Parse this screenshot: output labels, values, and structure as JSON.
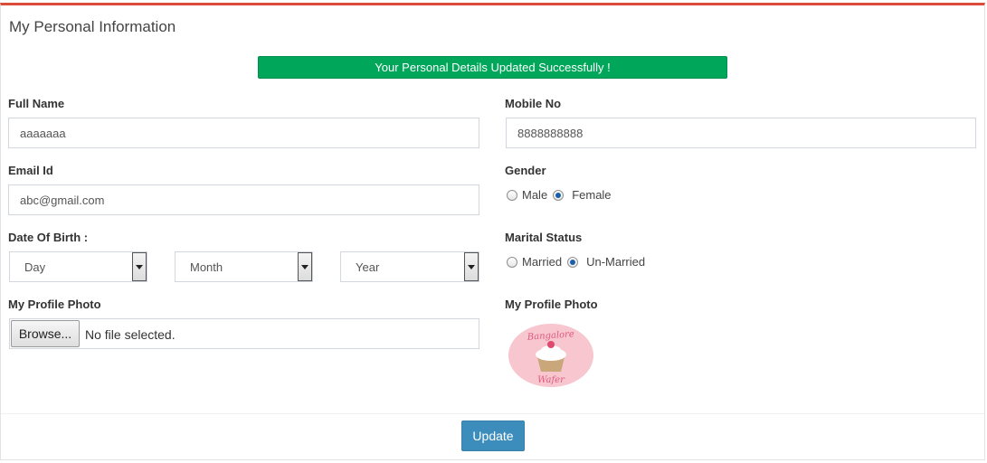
{
  "panel": {
    "title": "My Personal Information"
  },
  "alert": {
    "message": "Your Personal Details Updated Successfully !"
  },
  "fields": {
    "full_name": {
      "label": "Full Name",
      "value": "aaaaaaa"
    },
    "mobile": {
      "label": "Mobile No",
      "value": "8888888888"
    },
    "email": {
      "label": "Email Id",
      "value": "abc@gmail.com"
    },
    "gender": {
      "label": "Gender",
      "options": [
        "Male",
        "Female"
      ],
      "selected": "Female"
    },
    "dob": {
      "label": "Date Of Birth :",
      "day": "Day",
      "month": "Month",
      "year": "Year"
    },
    "marital_status": {
      "label": "Marital Status",
      "options": [
        "Married",
        "Un-Married"
      ],
      "selected": "Un-Married"
    },
    "photo_upload": {
      "label": "My Profile Photo",
      "browse_label": "Browse...",
      "status": "No file selected."
    },
    "photo_preview": {
      "label": "My Profile Photo",
      "logo_top": "Bangalore",
      "logo_bottom": "Wafer"
    }
  },
  "actions": {
    "update_label": "Update"
  },
  "colors": {
    "panel_top_border": "#dd4b39",
    "alert_success": "#00a65a",
    "primary_button": "#3c8dbc",
    "logo_circle": "#f7c6cf",
    "logo_text": "#e05a7a"
  }
}
